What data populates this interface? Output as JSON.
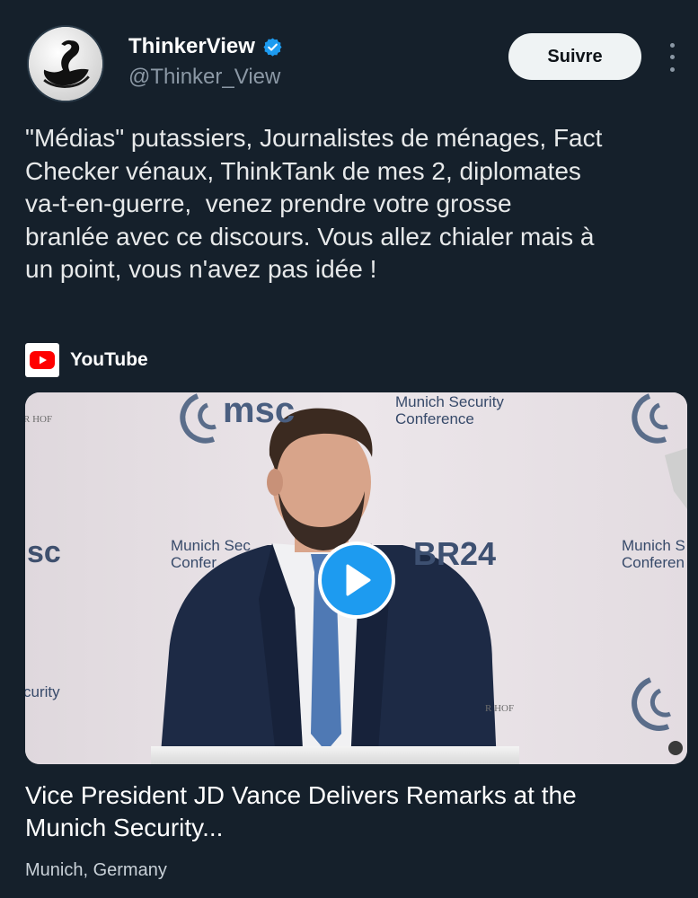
{
  "author": {
    "display_name": "ThinkerView",
    "handle": "@Thinker_View",
    "verified": true,
    "avatar_icon": "black-swan-logo"
  },
  "actions": {
    "follow_label": "Suivre",
    "more_icon": "more-vertical-icon"
  },
  "tweet": {
    "lines": [
      "\"Médias\" putassiers, Journalistes de ménages, Fact",
      "Checker vénaux, ThinkTank de mes 2, diplomates",
      "va-t-en-guerre,  venez prendre votre grosse",
      "branlée avec ce discours. Vous allez chialer mais à",
      "un point, vous n'avez pas idée !"
    ]
  },
  "embed": {
    "provider_label": "YouTube",
    "provider_icon": "youtube-logo-icon",
    "video": {
      "play_icon": "play-icon",
      "backdrop_text": {
        "msc": "msc",
        "sc": "sc",
        "munich_security_conference_top": [
          "Munich Security",
          "Conference"
        ],
        "munich_sec_mid": [
          "Munich Sec",
          "Confer"
        ],
        "munich_right": [
          "Munich S",
          "Conferen"
        ],
        "br24": "BR24",
        "bayerischer_hof_left": "R HOF",
        "bayerischer_hof_right": "R HOF",
        "curity": "curity"
      }
    },
    "title_lines": [
      "Vice President JD Vance Delivers Remarks at the",
      "Munich Security..."
    ],
    "location": "Munich, Germany"
  },
  "colors": {
    "background": "#15202b",
    "accent_blue": "#1d9bf0",
    "follow_button_bg": "#eff3f4",
    "youtube_red": "#ff0000",
    "secondary_text": "#8b98a5"
  }
}
